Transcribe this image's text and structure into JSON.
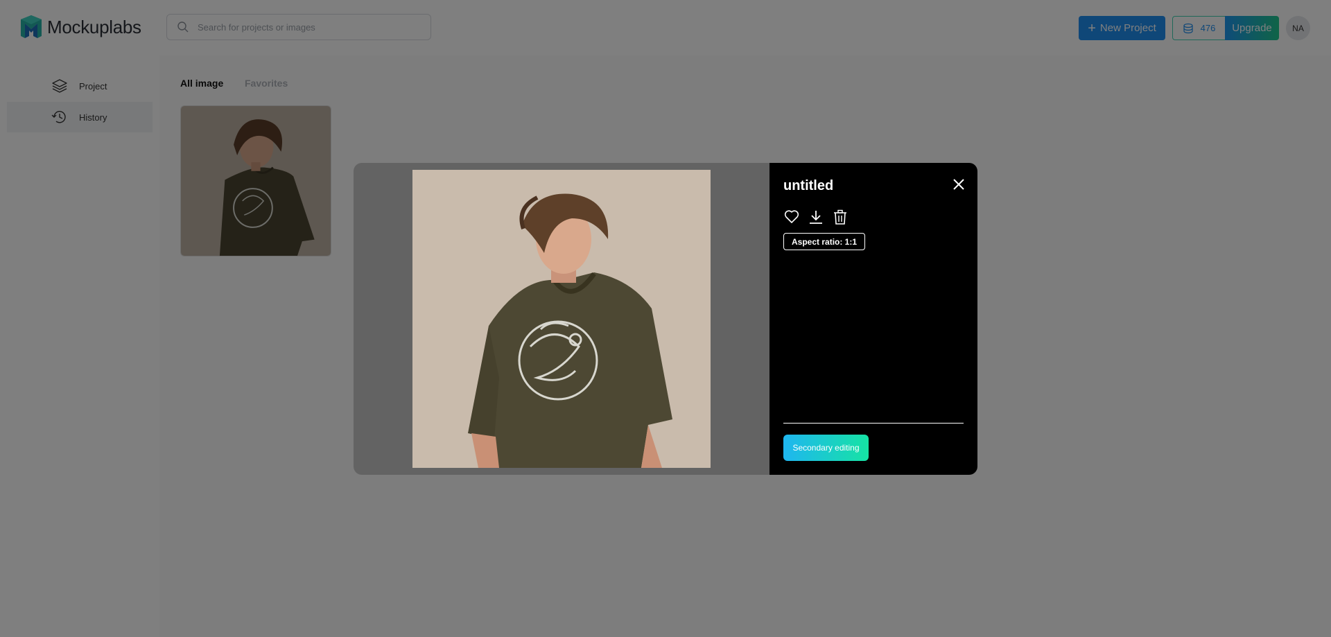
{
  "app": {
    "name": "Mockuplabs"
  },
  "header": {
    "search_placeholder": "Search for projects or images",
    "new_project_label": "New Project",
    "credits": "476",
    "upgrade_label": "Upgrade",
    "avatar_initials": "NA"
  },
  "sidebar": {
    "items": [
      {
        "label": "Project",
        "icon": "layers-icon",
        "active": false
      },
      {
        "label": "History",
        "icon": "history-icon",
        "active": true
      }
    ]
  },
  "main": {
    "tabs": [
      {
        "label": "All image",
        "active": true
      },
      {
        "label": "Favorites",
        "active": false
      }
    ]
  },
  "modal": {
    "title": "untitled",
    "aspect_ratio_label": "Aspect ratio: 1:1",
    "secondary_button": "Secondary editing",
    "actions": [
      "heart-icon",
      "download-icon",
      "trash-icon"
    ]
  },
  "colors": {
    "primary": "#1f8ff0",
    "accent_green": "#20c98f",
    "overlay": "rgba(0,0,0,0.5)"
  }
}
